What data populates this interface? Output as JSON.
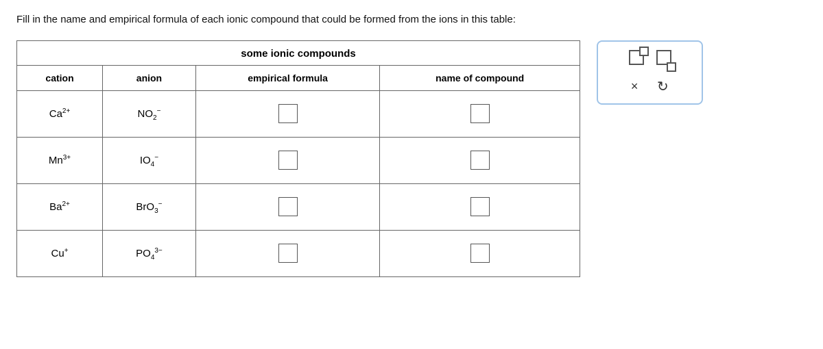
{
  "instruction": "Fill in the name and empirical formula of each ionic compound that could be formed from the ions in this table:",
  "table": {
    "title": "some ionic compounds",
    "headers": [
      "cation",
      "anion",
      "empirical formula",
      "name of compound"
    ],
    "rows": [
      {
        "cation_main": "Ca",
        "cation_sup": "2+",
        "anion_main": "NO",
        "anion_sub": "2",
        "anion_sup": "−"
      },
      {
        "cation_main": "Mn",
        "cation_sup": "3+",
        "anion_main": "IO",
        "anion_sub": "4",
        "anion_sup": "−"
      },
      {
        "cation_main": "Ba",
        "cation_sup": "2+",
        "anion_main": "BrO",
        "anion_sub": "3",
        "anion_sup": "−"
      },
      {
        "cation_main": "Cu",
        "cation_sup": "+",
        "anion_main": "PO",
        "anion_sub": "4",
        "anion_sup": "3−"
      }
    ]
  },
  "panel": {
    "x_label": "×",
    "undo_label": "↺"
  }
}
